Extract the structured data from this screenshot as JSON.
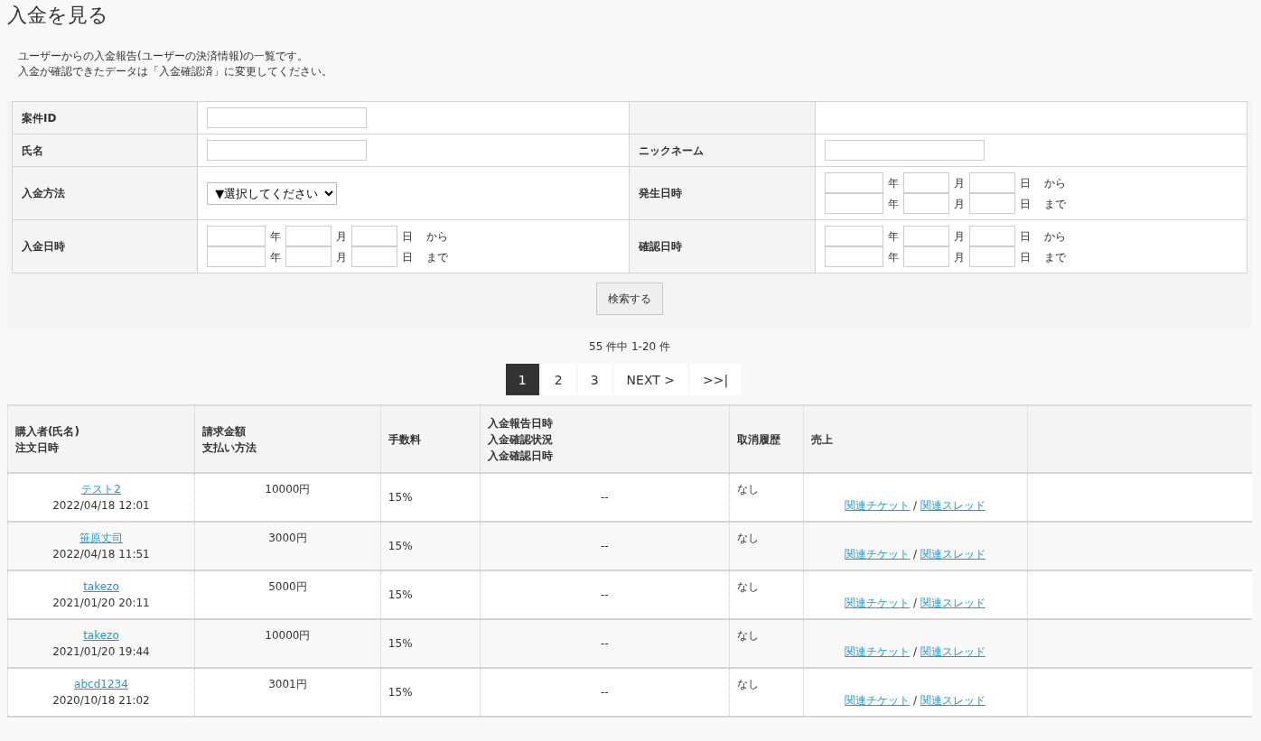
{
  "title": "入金を見る",
  "description": [
    "ユーザーからの入金報告(ユーザーの決済情報)の一覧です。",
    "入金が確認できたデータは「入金確認済」に変更してください。"
  ],
  "search_form": {
    "rows": [
      {
        "cells": [
          {
            "label": "案件ID",
            "kind": "text"
          },
          {
            "kind": "empty"
          }
        ]
      },
      {
        "cells": [
          {
            "label": "氏名",
            "kind": "text"
          },
          {
            "label": "ニックネーム",
            "kind": "text"
          }
        ]
      },
      {
        "cells": [
          {
            "label": "入金方法",
            "kind": "select",
            "value": "▼選択してください"
          },
          {
            "label": "発生日時",
            "kind": "date_range",
            "lines": [
              {
                "units": [
                  "年",
                  "月",
                  "日"
                ],
                "suffix": "から"
              },
              {
                "units": [
                  "年",
                  "月",
                  "日"
                ],
                "suffix": "まで"
              }
            ]
          }
        ]
      },
      {
        "cells": [
          {
            "label": "入金日時",
            "kind": "date_range",
            "lines": [
              {
                "units": [
                  "年",
                  "月",
                  "日"
                ],
                "suffix": "から"
              },
              {
                "units": [
                  "年",
                  "月",
                  "日"
                ],
                "suffix": "まで"
              }
            ]
          },
          {
            "label": "確認日時",
            "kind": "date_range",
            "lines": [
              {
                "units": [
                  "年",
                  "月",
                  "日"
                ],
                "suffix": "から"
              },
              {
                "units": [
                  "年",
                  "月",
                  "日"
                ],
                "suffix": "まで"
              }
            ]
          }
        ]
      }
    ],
    "button": "検索する"
  },
  "result_count": "55 件中 1-20 件",
  "pagination": [
    {
      "label": "1",
      "selected": true
    },
    {
      "label": "2",
      "selected": false
    },
    {
      "label": "3",
      "selected": false
    },
    {
      "label": "NEXT >",
      "selected": false
    },
    {
      "label": ">>|",
      "selected": false
    }
  ],
  "table": {
    "columns": [
      [
        "購入者(氏名)",
        "注文日時"
      ],
      [
        "請求金額",
        "支払い方法"
      ],
      [
        "手数料"
      ],
      [
        "入金報告日時",
        "入金確認状況",
        "入金確認日時"
      ],
      [
        "取消履歴"
      ],
      [
        "売上"
      ],
      []
    ],
    "rows": [
      {
        "buyer": "テスト2",
        "ordered": "2022/04/18 12:01",
        "amount": "10000円",
        "fee": "15%",
        "status": "--",
        "cancel": "なし",
        "links": [
          "関連チケット",
          "関連スレッド"
        ],
        "separator": "/"
      },
      {
        "buyer": "笹原丈司",
        "ordered": "2022/04/18 11:51",
        "amount": "3000円",
        "fee": "15%",
        "status": "--",
        "cancel": "なし",
        "links": [
          "関連チケット",
          "関連スレッド"
        ],
        "separator": "/"
      },
      {
        "buyer": "takezo",
        "ordered": "2021/01/20 20:11",
        "amount": "5000円",
        "fee": "15%",
        "status": "--",
        "cancel": "なし",
        "links": [
          "関連チケット",
          "関連スレッド"
        ],
        "separator": "/"
      },
      {
        "buyer": "takezo",
        "ordered": "2021/01/20 19:44",
        "amount": "10000円",
        "fee": "15%",
        "status": "--",
        "cancel": "なし",
        "links": [
          "関連チケット",
          "関連スレッド"
        ],
        "separator": "/"
      },
      {
        "buyer": "abcd1234",
        "ordered": "2020/10/18 21:02",
        "amount": "3001円",
        "fee": "15%",
        "status": "--",
        "cancel": "なし",
        "links": [
          "関連チケット",
          "関連スレッド"
        ],
        "separator": "/"
      }
    ]
  }
}
